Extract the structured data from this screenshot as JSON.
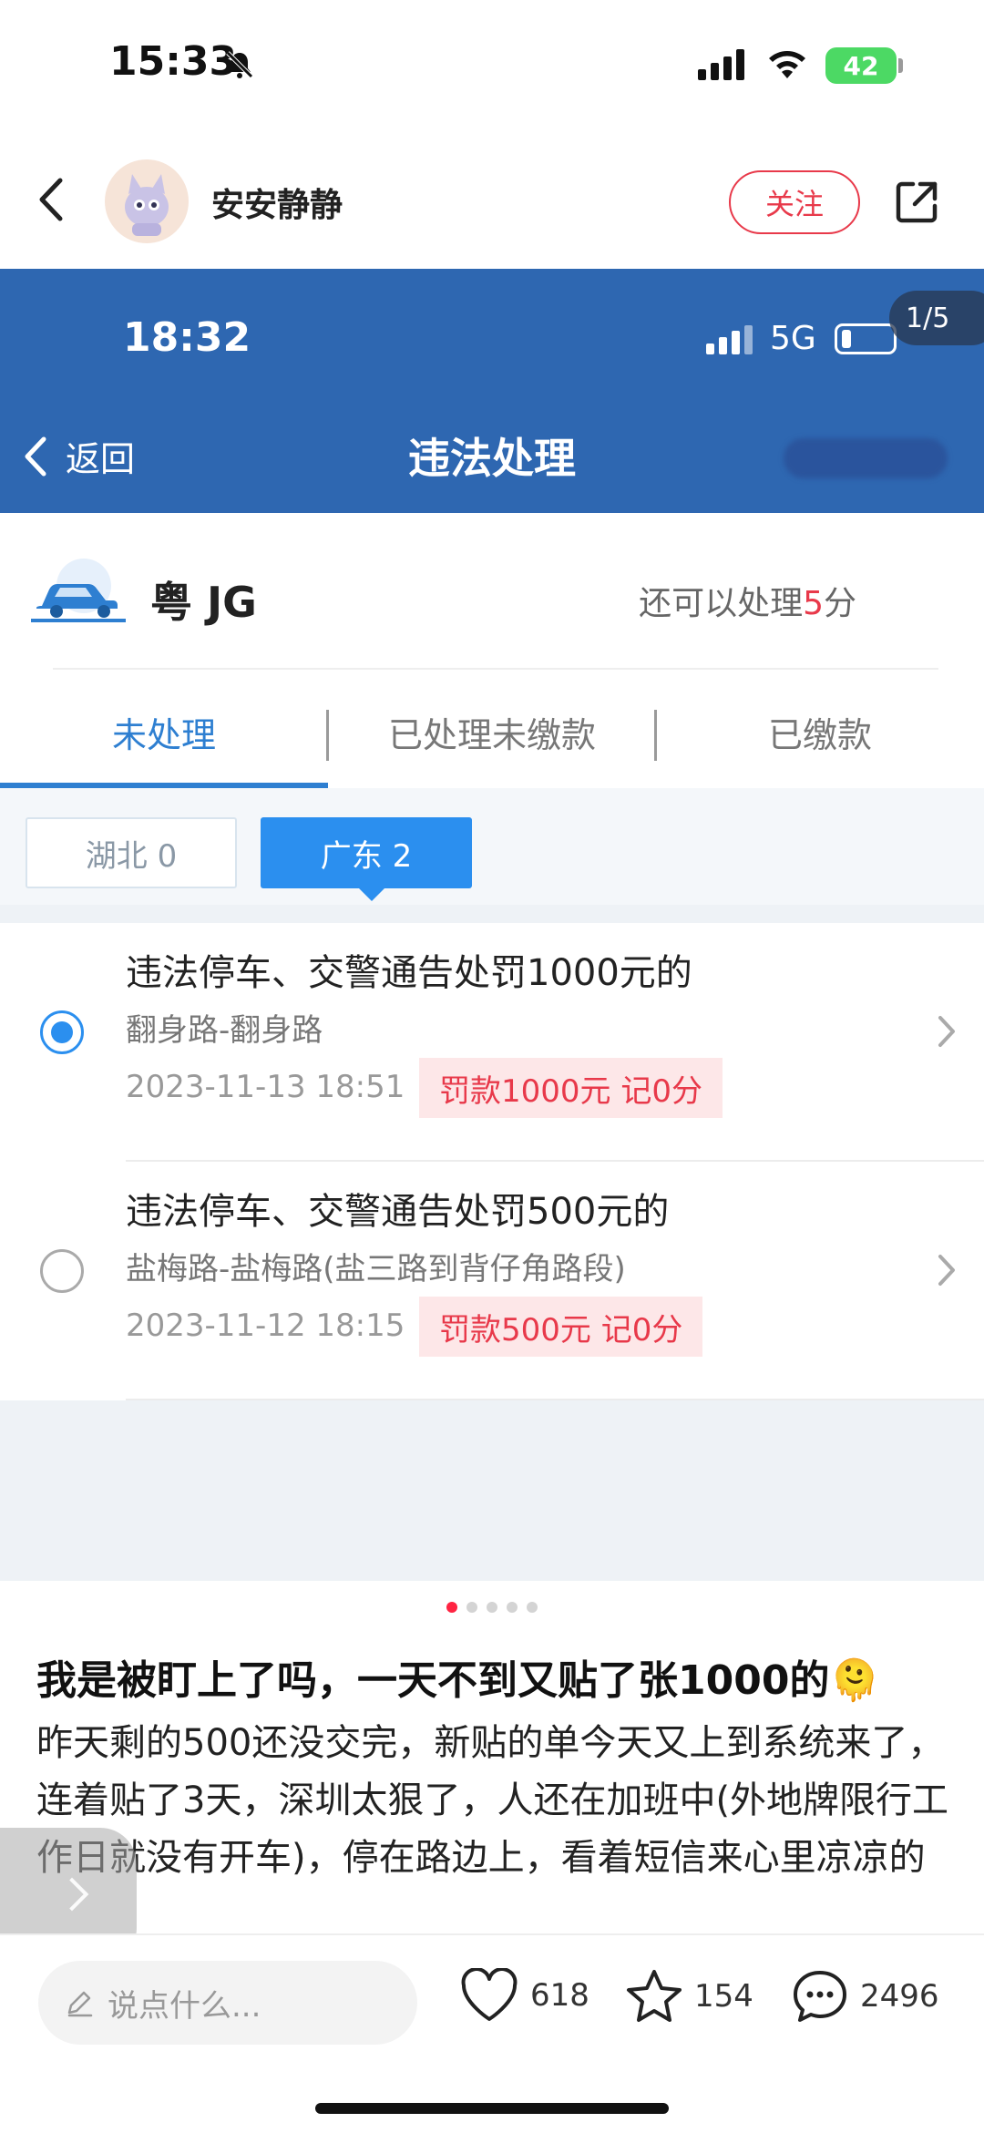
{
  "status_bar": {
    "time": "15:33",
    "battery": "42"
  },
  "post_header": {
    "author": "安安静静",
    "follow_label": "关注"
  },
  "screenshot": {
    "status_time": "18:32",
    "network": "5G",
    "image_counter": "1/5",
    "nav": {
      "back_label": "返回",
      "title": "违法处理"
    },
    "vehicle": {
      "plate": "粤 JG",
      "remaining_prefix": "还可以处理",
      "remaining_points": "5",
      "remaining_suffix": "分"
    },
    "tabs": [
      {
        "label": "未处理",
        "active": true
      },
      {
        "label": "已处理未缴款",
        "active": false
      },
      {
        "label": "已缴款",
        "active": false
      }
    ],
    "provinces": [
      {
        "label": "湖北 0",
        "active": false
      },
      {
        "label": "广东 2",
        "active": true
      }
    ],
    "violations": [
      {
        "title": "违法停车、交警通告处罚1000元的",
        "location": "翻身路-翻身路",
        "datetime": "2023-11-13 18:51",
        "fine": "罚款1000元  记0分",
        "selected": true
      },
      {
        "title": "违法停车、交警通告处罚500元的",
        "location": "盐梅路-盐梅路(盐三路到背仔角路段)",
        "datetime": "2023-11-12 18:15",
        "fine": "罚款500元  记0分",
        "selected": false
      }
    ]
  },
  "pager": {
    "total": 5,
    "current": 1
  },
  "post": {
    "title": "我是被盯上了吗，一天不到又贴了张1000的🫠",
    "body": "昨天剩的500还没交完，新贴的单今天又上到系统来了，连着贴了3天，深圳太狠了，人还在加班中(外地牌限行工作日就没有开车)，停在路边上，看着短信来心里凉凉的"
  },
  "bottom_bar": {
    "comment_placeholder": "说点什么...",
    "likes": "618",
    "stars": "154",
    "comments": "2496"
  },
  "colors": {
    "accent_red": "#e8394a",
    "inner_blue": "#2e67b1",
    "tab_blue": "#2e7fd1"
  }
}
